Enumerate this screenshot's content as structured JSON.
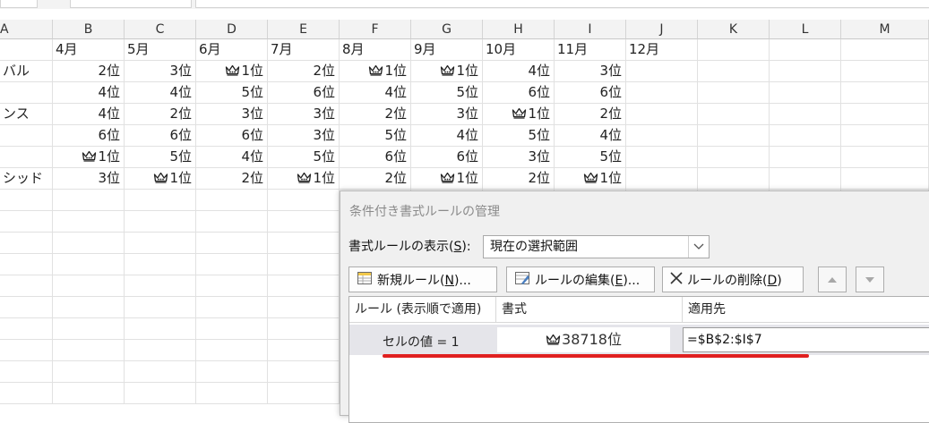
{
  "columns": [
    "A",
    "B",
    "C",
    "D",
    "E",
    "F",
    "G",
    "H",
    "I",
    "J",
    "K",
    "L",
    "M"
  ],
  "sheet": {
    "header_row": [
      "",
      "4月",
      "5月",
      "6月",
      "7月",
      "8月",
      "9月",
      "10月",
      "11月",
      "12月"
    ],
    "rows": [
      {
        "a": "バル",
        "cells": [
          [
            "",
            "2位"
          ],
          [
            "",
            "3位"
          ],
          [
            "c",
            "1位"
          ],
          [
            "",
            "2位"
          ],
          [
            "c",
            "1位"
          ],
          [
            "c",
            "1位"
          ],
          [
            "",
            "4位"
          ],
          [
            "",
            "3位"
          ]
        ]
      },
      {
        "a": "",
        "cells": [
          [
            "",
            "4位"
          ],
          [
            "",
            "4位"
          ],
          [
            "",
            "5位"
          ],
          [
            "",
            "6位"
          ],
          [
            "",
            "4位"
          ],
          [
            "",
            "5位"
          ],
          [
            "",
            "6位"
          ],
          [
            "",
            "6位"
          ]
        ]
      },
      {
        "a": "ンス",
        "cells": [
          [
            "",
            "4位"
          ],
          [
            "",
            "2位"
          ],
          [
            "",
            "3位"
          ],
          [
            "",
            "3位"
          ],
          [
            "",
            "2位"
          ],
          [
            "",
            "3位"
          ],
          [
            "c",
            "1位"
          ],
          [
            "",
            "2位"
          ]
        ]
      },
      {
        "a": "",
        "cells": [
          [
            "",
            "6位"
          ],
          [
            "",
            "6位"
          ],
          [
            "",
            "6位"
          ],
          [
            "",
            "3位"
          ],
          [
            "",
            "5位"
          ],
          [
            "",
            "4位"
          ],
          [
            "",
            "5位"
          ],
          [
            "",
            "4位"
          ]
        ]
      },
      {
        "a": "",
        "cells": [
          [
            "c",
            "1位"
          ],
          [
            "",
            "5位"
          ],
          [
            "",
            "4位"
          ],
          [
            "",
            "5位"
          ],
          [
            "",
            "6位"
          ],
          [
            "",
            "6位"
          ],
          [
            "",
            "3位"
          ],
          [
            "",
            "5位"
          ]
        ]
      },
      {
        "a": "シッド",
        "cells": [
          [
            "",
            "3位"
          ],
          [
            "c",
            "1位"
          ],
          [
            "",
            "2位"
          ],
          [
            "c",
            "1位"
          ],
          [
            "",
            "2位"
          ],
          [
            "c",
            "1位"
          ],
          [
            "",
            "2位"
          ],
          [
            "c",
            "1位"
          ]
        ]
      }
    ]
  },
  "dialog": {
    "title": "条件付き書式ルールの管理",
    "scope_label": "書式ルールの表示(",
    "scope_key": "S",
    "scope_label_end": "):",
    "scope_value": "現在の選択範囲",
    "buttons": {
      "new_rule": "新規ルール(",
      "new_rule_key": "N",
      "new_rule_end": ")...",
      "edit_rule": "ルールの編集(",
      "edit_rule_key": "E",
      "edit_rule_end": ")...",
      "delete_rule": "ルールの削除(",
      "delete_rule_key": "D",
      "delete_rule_end": ")"
    },
    "list_headers": {
      "rule": "ルール (表示順で適用)",
      "format": "書式",
      "applies_to": "適用先"
    },
    "rule": {
      "name": "セルの値 = 1",
      "format_preview": "38718位",
      "applies_to": "=$B$2:$I$7"
    }
  },
  "colors": {
    "header_bg": "#f3f3f3",
    "dialog_bg": "#f0f0f0",
    "selected_row": "#e5e5ea",
    "annotation_underline": "#e02020"
  }
}
